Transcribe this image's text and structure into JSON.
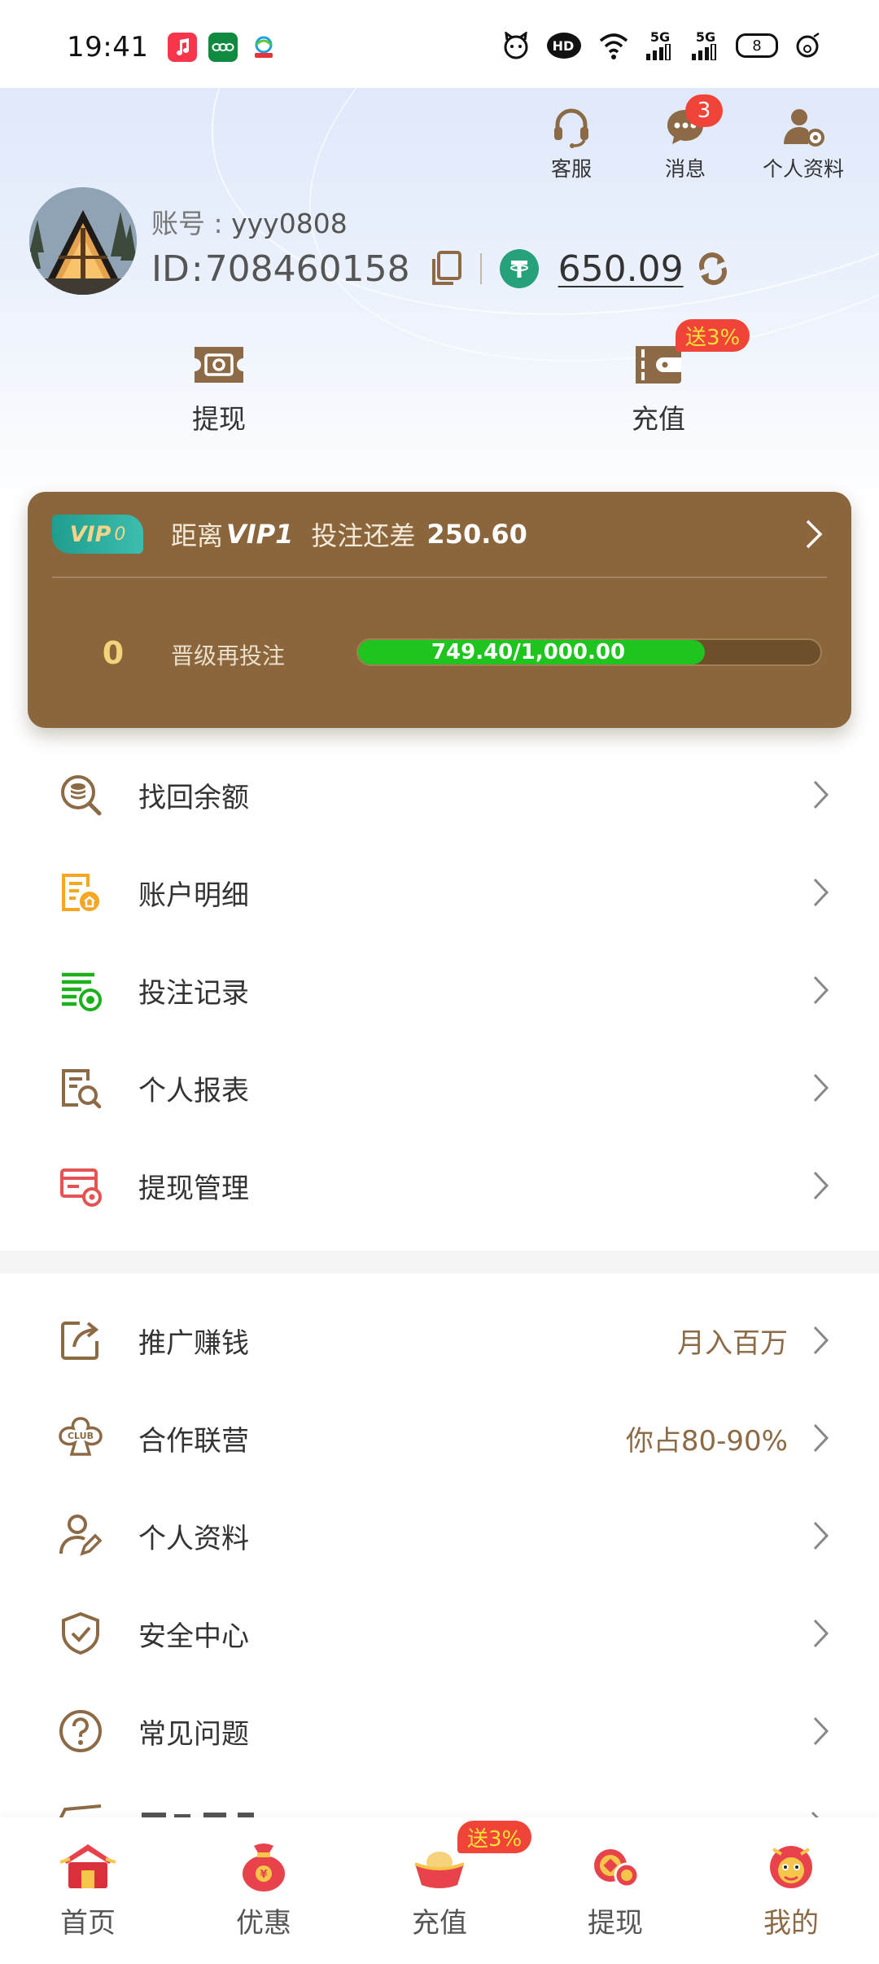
{
  "status_bar": {
    "time": "19:41",
    "apps": [
      "music-app-icon",
      "oppo-app-icon",
      "china-mobile-app-icon"
    ],
    "right_icons": [
      "cat-icon",
      "hd-icon",
      "wifi-icon",
      "signal-5g-1-icon",
      "signal-5g-2-icon"
    ],
    "signal1_label": "5G",
    "signal2_label": "5G",
    "hd_label": "HD",
    "battery_level": "8"
  },
  "header": {
    "top_actions": [
      {
        "label": "客服",
        "icon": "headset-icon"
      },
      {
        "label": "消息",
        "icon": "message-icon",
        "badge": "3"
      },
      {
        "label": "个人资料",
        "icon": "profile-settings-icon"
      }
    ],
    "account_label": "账号",
    "account_sep": ":",
    "account_value": "yyy0808",
    "id_label": "ID",
    "id_sep": ":",
    "id_value": "708460158",
    "balance": "650.09",
    "currency_icon": "usdt-icon",
    "quick_actions": {
      "withdraw": {
        "label": "提现",
        "icon": "cash-icon"
      },
      "deposit": {
        "label": "充值",
        "icon": "wallet-icon",
        "promo": "送3%"
      }
    }
  },
  "vip": {
    "badge_text": "VIP",
    "badge_level": "0",
    "distance_label": "距离",
    "next_level": "VIP1",
    "need_label": "投注还差",
    "need_amount": "250.60",
    "current_level": "0",
    "progress_label": "晋级再投注",
    "progress_text": "749.40/1,000.00",
    "progress_fraction": 0.7494
  },
  "menu_group1": [
    {
      "label": "找回余额",
      "icon": "recover-balance-icon",
      "color": "#8b6a45"
    },
    {
      "label": "账户明细",
      "icon": "account-details-icon",
      "color": "#f5a623"
    },
    {
      "label": "投注记录",
      "icon": "bet-records-icon",
      "color": "#1cb01c"
    },
    {
      "label": "个人报表",
      "icon": "personal-report-icon",
      "color": "#8b6a45"
    },
    {
      "label": "提现管理",
      "icon": "withdraw-management-icon",
      "color": "#e55353"
    }
  ],
  "menu_group2": [
    {
      "label": "推广赚钱",
      "icon": "share-icon",
      "extra": "月入百万"
    },
    {
      "label": "合作联营",
      "icon": "club-icon",
      "extra": "你占80-90%"
    },
    {
      "label": "个人资料",
      "icon": "user-edit-icon",
      "extra": ""
    },
    {
      "label": "安全中心",
      "icon": "shield-icon",
      "extra": ""
    },
    {
      "label": "常见问题",
      "icon": "question-icon",
      "extra": ""
    }
  ],
  "bottom_nav": [
    {
      "label": "首页",
      "icon": "home-icon"
    },
    {
      "label": "优惠",
      "icon": "promo-bag-icon"
    },
    {
      "label": "充值",
      "icon": "deposit-ingot-icon",
      "promo": "送3%"
    },
    {
      "label": "提现",
      "icon": "withdraw-coins-icon"
    },
    {
      "label": "我的",
      "icon": "mine-lion-icon",
      "active": true
    }
  ],
  "colors": {
    "brand_brown": "#8b6a45",
    "vip_card": "#8b653b",
    "badge_red": "#f04438",
    "progress_green": "#1fc41f",
    "usdt_green": "#26a17b"
  }
}
